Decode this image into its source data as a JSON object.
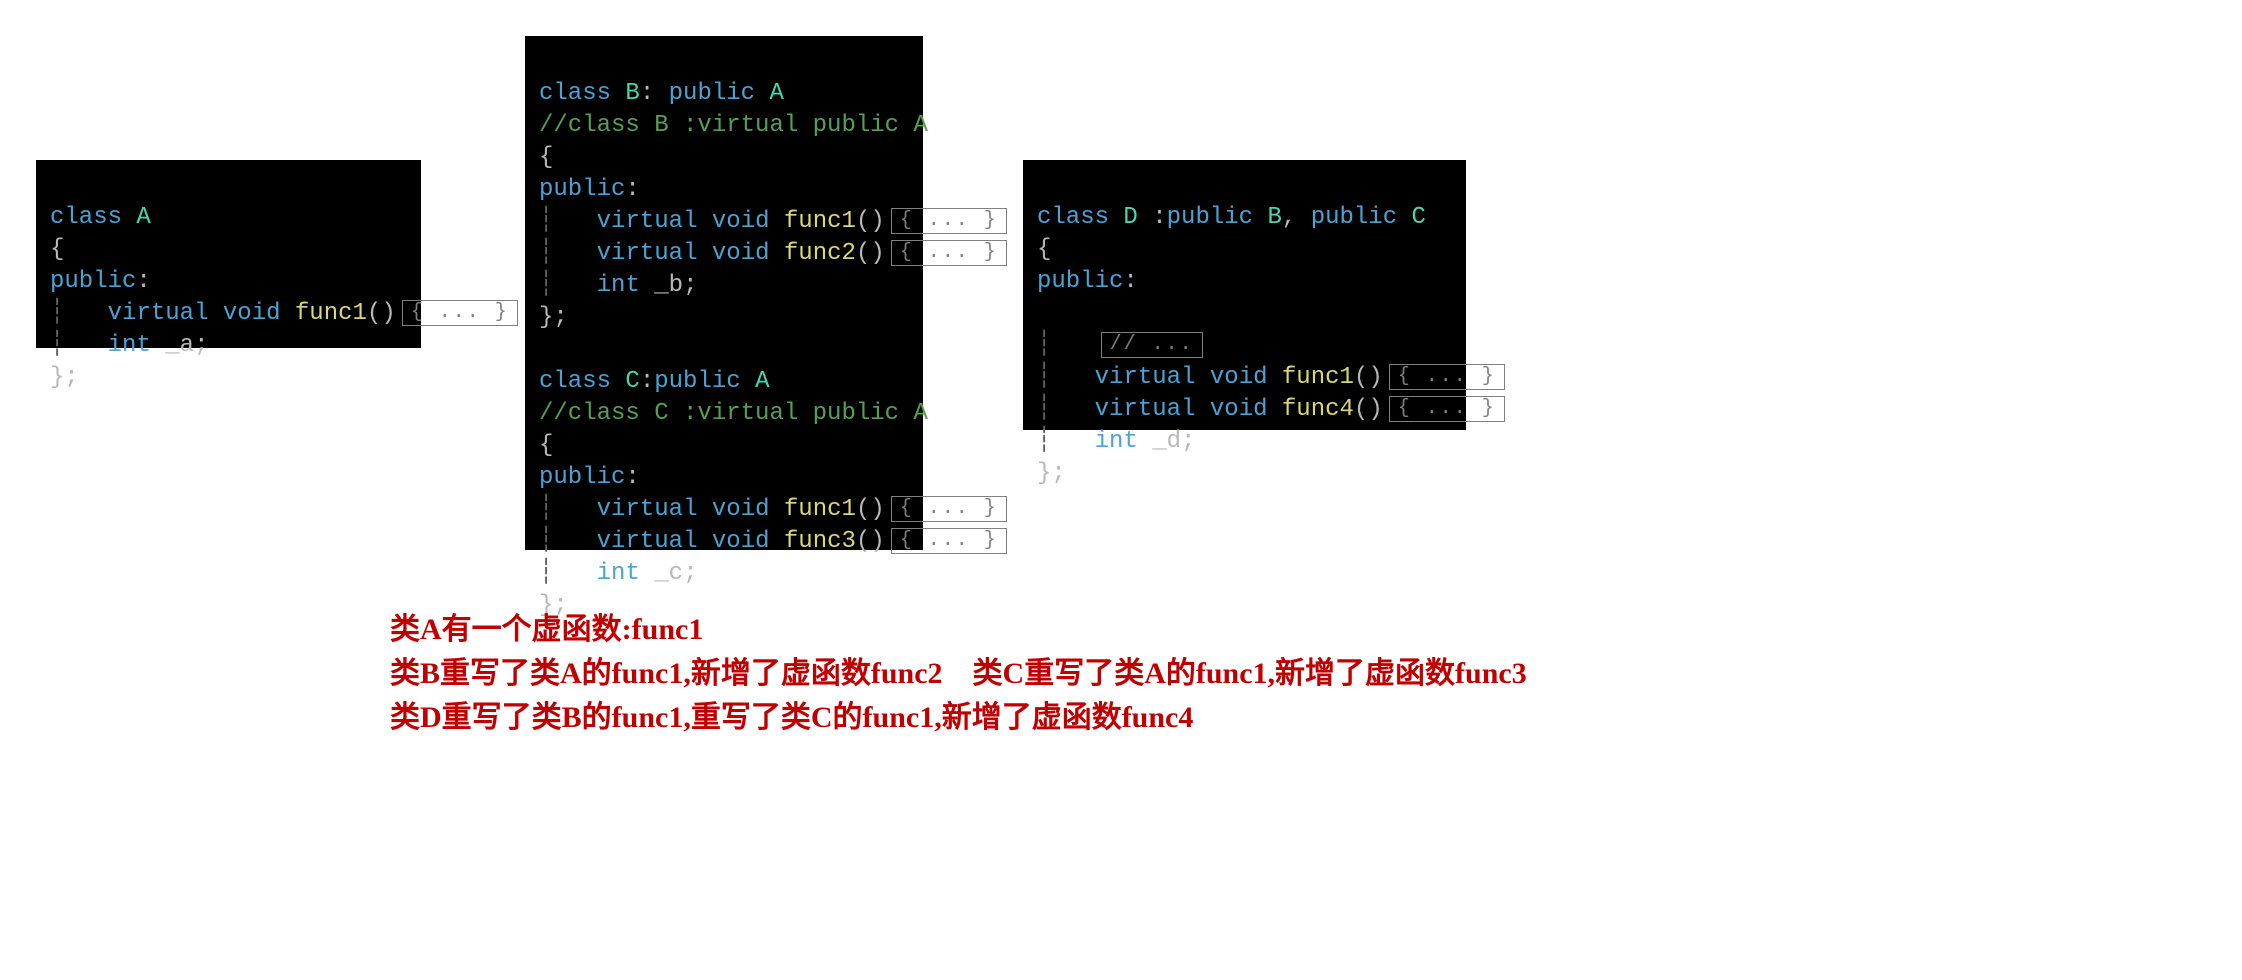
{
  "blockA": {
    "l1_kw_class": "class",
    "l1_name": "A",
    "l2_brace": "{",
    "l3_kw_public": "public",
    "l3_colon": ":",
    "l4_virtual": "virtual",
    "l4_void": "void",
    "l4_func": "func1",
    "l4_paren": "()",
    "l4_fold": "{ ... }",
    "l5_int": "int",
    "l5_var": "_a",
    "l5_semi": ";",
    "l6_close": "};"
  },
  "blockB": {
    "l1_kw_class": "class",
    "l1_name": "B",
    "l1_colon": ":",
    "l1_public": "public",
    "l1_base": "A",
    "l2_comment": "//class B :virtual public A",
    "l3_brace": "{",
    "l4_kw_public": "public",
    "l4_colon": ":",
    "l5_virtual": "virtual",
    "l5_void": "void",
    "l5_func": "func1",
    "l5_paren": "()",
    "l5_fold": "{ ... }",
    "l6_virtual": "virtual",
    "l6_void": "void",
    "l6_func": "func2",
    "l6_paren": "()",
    "l6_fold": "{ ... }",
    "l7_int": "int",
    "l7_var": "_b",
    "l7_semi": ";",
    "l8_close": "};"
  },
  "blockC": {
    "l1_kw_class": "class",
    "l1_name": "C",
    "l1_colon": ":",
    "l1_public": "public",
    "l1_base": "A",
    "l2_comment": "//class C :virtual public A",
    "l3_brace": "{",
    "l4_kw_public": "public",
    "l4_colon": ":",
    "l5_virtual": "virtual",
    "l5_void": "void",
    "l5_func": "func1",
    "l5_paren": "()",
    "l5_fold": "{ ... }",
    "l6_virtual": "virtual",
    "l6_void": "void",
    "l6_func": "func3",
    "l6_paren": "()",
    "l6_fold": "{ ... }",
    "l7_int": "int",
    "l7_var": "_c",
    "l7_semi": ";",
    "l8_close": "};"
  },
  "blockD": {
    "l1_kw_class": "class",
    "l1_name": "D",
    "l1_colon": ":",
    "l1_public1": "public",
    "l1_base1": "B",
    "l1_comma": ",",
    "l1_public2": "public",
    "l1_base2": "C",
    "l2_brace": "{",
    "l3_kw_public": "public",
    "l3_colon": ":",
    "l4_fold_comment": "// ...",
    "l5_virtual": "virtual",
    "l5_void": "void",
    "l5_func": "func1",
    "l5_paren": "()",
    "l5_fold": "{ ... }",
    "l6_virtual": "virtual",
    "l6_void": "void",
    "l6_func": "func4",
    "l6_paren": "()",
    "l6_fold": "{ ... }",
    "l7_int": "int",
    "l7_var": "_d",
    "l7_semi": ";",
    "l8_close": "};"
  },
  "captions": {
    "line1": "类A有一个虚函数:func1",
    "line2": "类B重写了类A的func1,新增了虚函数func2    类C重写了类A的func1,新增了虚函数func3",
    "line3": "类D重写了类B的func1,重写了类C的func1,新增了虚函数func4"
  }
}
